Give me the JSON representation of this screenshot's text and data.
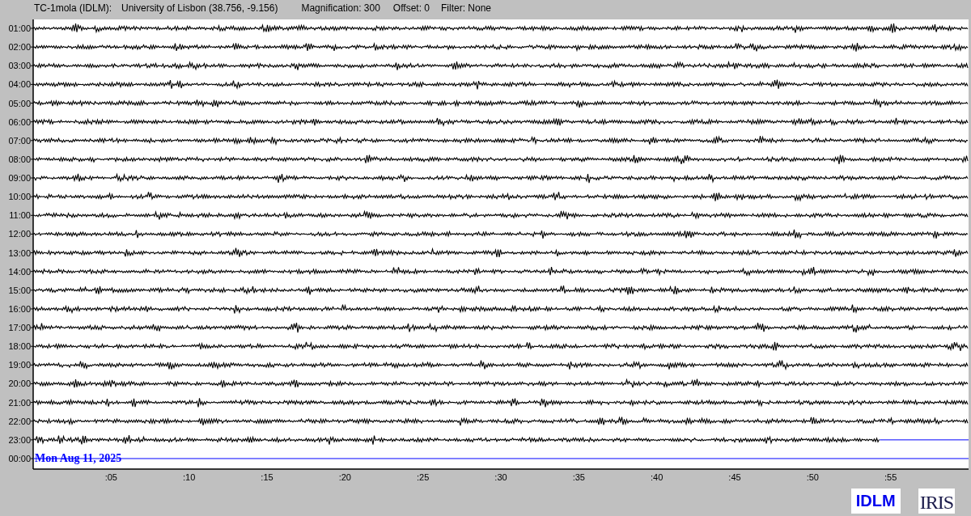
{
  "header": {
    "station": "TC-1mola (IDLM):",
    "location": "University of Lisbon (38.756, -9.156)",
    "magnification": "Magnification: 300",
    "offset": "Offset: 0",
    "filter": "Filter: None"
  },
  "helicorder": {
    "rows": [
      {
        "label": "01:00",
        "kind": "trace",
        "level": 1
      },
      {
        "label": "02:00",
        "kind": "trace",
        "level": 1
      },
      {
        "label": "03:00",
        "kind": "trace",
        "level": 1
      },
      {
        "label": "04:00",
        "kind": "trace",
        "level": 1
      },
      {
        "label": "05:00",
        "kind": "trace",
        "level": 1
      },
      {
        "label": "06:00",
        "kind": "trace",
        "level": 1
      },
      {
        "label": "07:00",
        "kind": "trace",
        "level": 1
      },
      {
        "label": "08:00",
        "kind": "trace",
        "level": 1
      },
      {
        "label": "09:00",
        "kind": "trace",
        "level": 1
      },
      {
        "label": "10:00",
        "kind": "trace",
        "level": 1
      },
      {
        "label": "11:00",
        "kind": "trace",
        "level": 1
      },
      {
        "label": "12:00",
        "kind": "trace",
        "level": 1
      },
      {
        "label": "13:00",
        "kind": "trace",
        "level": 1
      },
      {
        "label": "14:00",
        "kind": "trace",
        "level": 1
      },
      {
        "label": "15:00",
        "kind": "trace",
        "level": 1
      },
      {
        "label": "16:00",
        "kind": "trace",
        "level": 1
      },
      {
        "label": "17:00",
        "kind": "trace",
        "level": 1
      },
      {
        "label": "18:00",
        "kind": "trace",
        "level": 1
      },
      {
        "label": "19:00",
        "kind": "trace",
        "level": 1
      },
      {
        "label": "20:00",
        "kind": "trace",
        "level": 1
      },
      {
        "label": "21:00",
        "kind": "trace",
        "level": 1
      },
      {
        "label": "22:00",
        "kind": "trace",
        "level": 1
      },
      {
        "label": "23:00",
        "kind": "trace",
        "level": 0.905
      },
      {
        "label": "00:00",
        "kind": "empty"
      }
    ],
    "date": "Mon Aug 11, 2025",
    "x_ticks": [
      ":05",
      ":10",
      ":15",
      ":20",
      ":25",
      ":30",
      ":35",
      ":40",
      ":45",
      ":50",
      ":55"
    ]
  },
  "logos": [
    {
      "kind": "idlm",
      "text": "IDLM"
    },
    {
      "kind": "iris",
      "text": "IRIS"
    }
  ]
}
